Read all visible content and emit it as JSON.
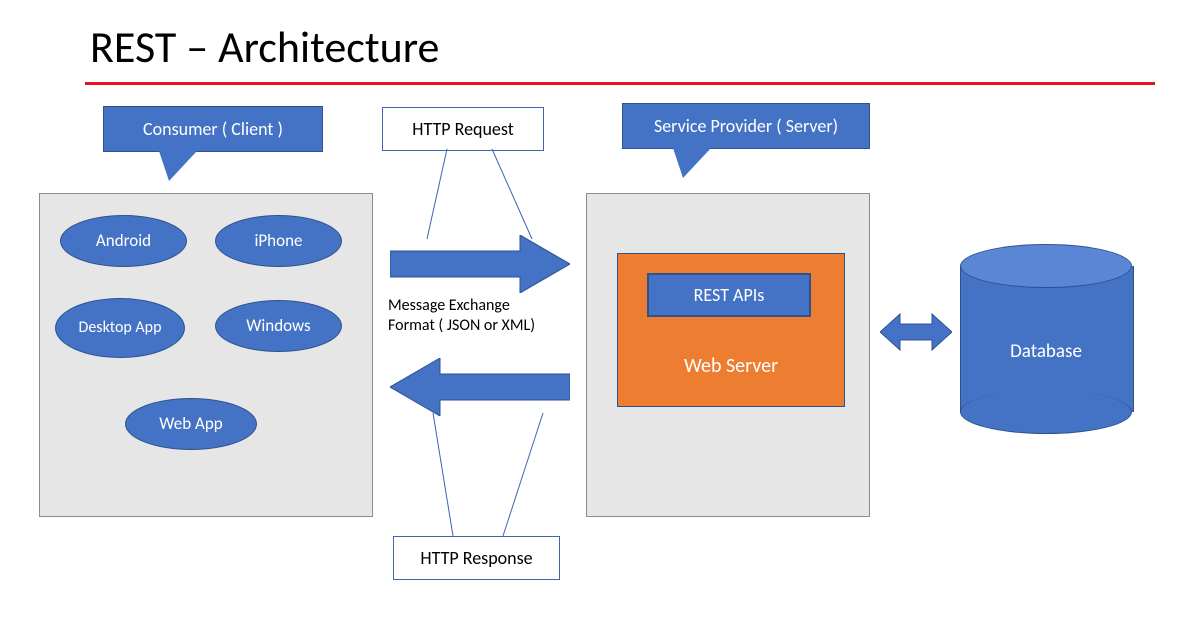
{
  "title": "REST – Architecture",
  "callouts": {
    "client": "Consumer ( Client )",
    "server": "Service Provider ( Server)"
  },
  "labels": {
    "http_request": "HTTP Request",
    "http_response": "HTTP Response",
    "message_line1": "Message Exchange",
    "message_line2": "Format ( JSON  or XML)"
  },
  "clients": {
    "android": "Android",
    "iphone": "iPhone",
    "desktop": "Desktop App",
    "windows": "Windows",
    "webapp": "Web App"
  },
  "server": {
    "rest_apis": "REST APIs",
    "web_server": "Web Server"
  },
  "database": "Database",
  "colors": {
    "blue": "#4472c4",
    "blue_border": "#2f528f",
    "orange": "#ed7d31",
    "red": "#e81123",
    "panel_bg": "#e6e6e6"
  }
}
